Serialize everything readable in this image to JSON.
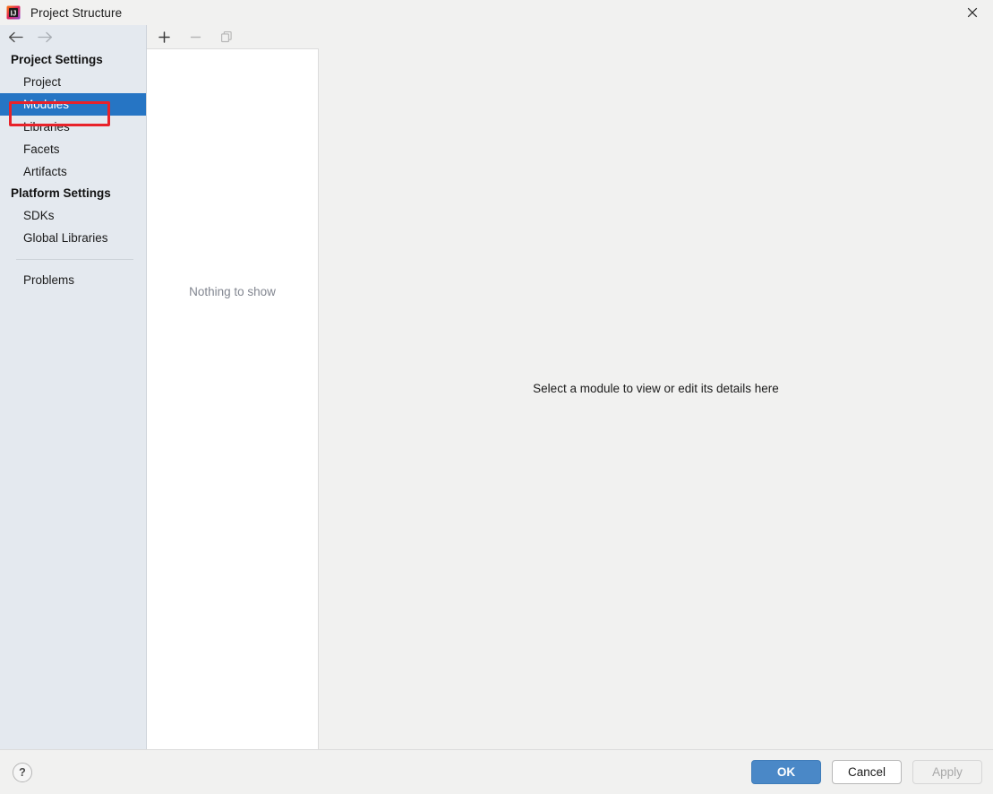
{
  "window": {
    "title": "Project Structure",
    "icon": "intellij-idea-logo-icon",
    "close_label": "✕"
  },
  "navigation": {
    "back_label": "←",
    "forward_label": "→"
  },
  "sidebar": {
    "groups": [
      {
        "title": "Project Settings",
        "items": [
          {
            "label": "Project",
            "selected": false
          },
          {
            "label": "Modules",
            "selected": true
          },
          {
            "label": "Libraries",
            "selected": false
          },
          {
            "label": "Facets",
            "selected": false
          },
          {
            "label": "Artifacts",
            "selected": false
          }
        ]
      },
      {
        "title": "Platform Settings",
        "items": [
          {
            "label": "SDKs",
            "selected": false
          },
          {
            "label": "Global Libraries",
            "selected": false
          }
        ]
      }
    ],
    "footer_items": [
      {
        "label": "Problems",
        "selected": false
      }
    ],
    "selection_color": "#2675c4",
    "background_color": "#e4e9ef"
  },
  "annotation": {
    "target": "Modules",
    "color": "#e8222a"
  },
  "modules_panel": {
    "toolbar": [
      {
        "name": "add-module-button",
        "glyph": "+",
        "enabled": true
      },
      {
        "name": "remove-module-button",
        "glyph": "−",
        "enabled": false
      },
      {
        "name": "copy-module-button",
        "glyph": "copy-icon",
        "enabled": false
      }
    ],
    "empty_text": "Nothing to show"
  },
  "detail_panel": {
    "message": "Select a module to view or edit its details here"
  },
  "bottom_bar": {
    "help_label": "?",
    "buttons": [
      {
        "label": "OK",
        "style": "primary",
        "enabled": true
      },
      {
        "label": "Cancel",
        "style": "normal",
        "enabled": true
      },
      {
        "label": "Apply",
        "style": "disabled",
        "enabled": false
      }
    ]
  }
}
